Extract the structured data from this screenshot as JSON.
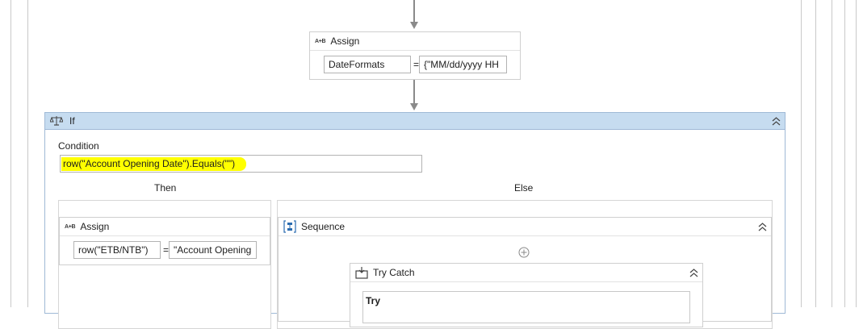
{
  "assign_top": {
    "title": "Assign",
    "to": "DateFormats",
    "eq": "=",
    "value": "{\"MM/dd/yyyy HH"
  },
  "if_activity": {
    "title": "If",
    "condition_label": "Condition",
    "condition_value": "row(\"Account Opening Date\").Equals(\"\")",
    "condition_highlight_color": "#ffff00",
    "then_label": "Then",
    "else_label": "Else",
    "header_color": "#c6dcf0"
  },
  "then_assign": {
    "title": "Assign",
    "to": "row(\"ETB/NTB\")",
    "eq": "=",
    "value": "\"Account Opening"
  },
  "sequence": {
    "title": "Sequence"
  },
  "try_catch": {
    "title": "Try Catch",
    "try_label": "Try"
  },
  "icons": {
    "assign": "A+B",
    "if": "scale-icon",
    "sequence": "sequence-icon",
    "try_catch": "try-catch-icon",
    "collapse": "double-chevron-up-icon",
    "add": "plus-circle-icon"
  }
}
